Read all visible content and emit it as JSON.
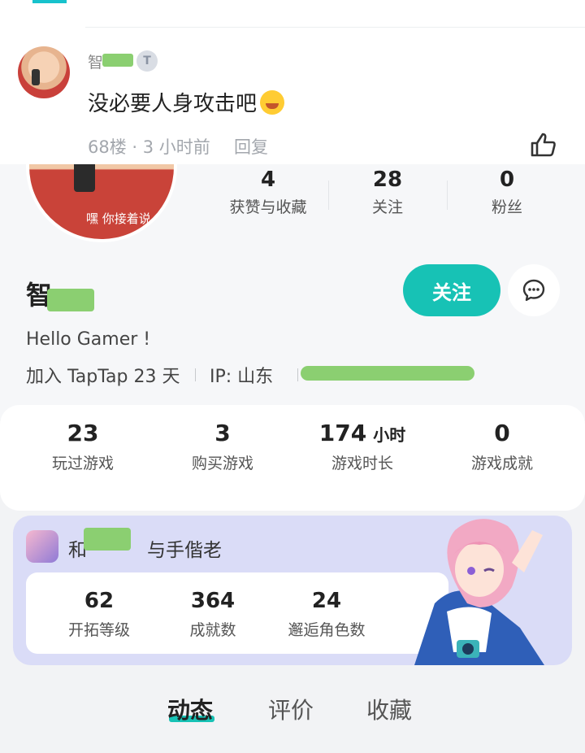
{
  "comment": {
    "author_visible": "智",
    "badge": "T",
    "text": "没必要人身攻击吧",
    "emoji": "smiling-face-icon",
    "meta": "68楼 · 3 小时前",
    "reply_label": "回复"
  },
  "profile": {
    "avatar_caption": "嘿 你接着说",
    "stats": [
      {
        "value": "4",
        "label": "获赞与收藏"
      },
      {
        "value": "28",
        "label": "关注"
      },
      {
        "value": "0",
        "label": "粉丝"
      }
    ],
    "name_visible": "智",
    "follow_label": "关注",
    "bio": "Hello Gamer !",
    "join": "加入 TapTap 23 天",
    "ip": "IP:  山东"
  },
  "games": {
    "stats": [
      {
        "value": "23",
        "unit": "",
        "label": "玩过游戏"
      },
      {
        "value": "3",
        "unit": "",
        "label": "购买游戏"
      },
      {
        "value": "174",
        "unit": "小时",
        "label": "游戏时长"
      },
      {
        "value": "0",
        "unit": "",
        "label": "游戏成就"
      }
    ]
  },
  "featured": {
    "title_prefix": "和",
    "title_suffix": "与手偕老",
    "stats": [
      {
        "value": "62",
        "label": "开拓等级"
      },
      {
        "value": "364",
        "label": "成就数"
      },
      {
        "value": "24",
        "label": "邂逅角色数"
      }
    ]
  },
  "tabs": [
    {
      "label": "动态",
      "active": true
    },
    {
      "label": "评价",
      "active": false
    },
    {
      "label": "收藏",
      "active": false
    }
  ],
  "colors": {
    "accent": "#17c2b5",
    "card_bg": "#dadcf7",
    "redaction": "#8bcf71"
  }
}
